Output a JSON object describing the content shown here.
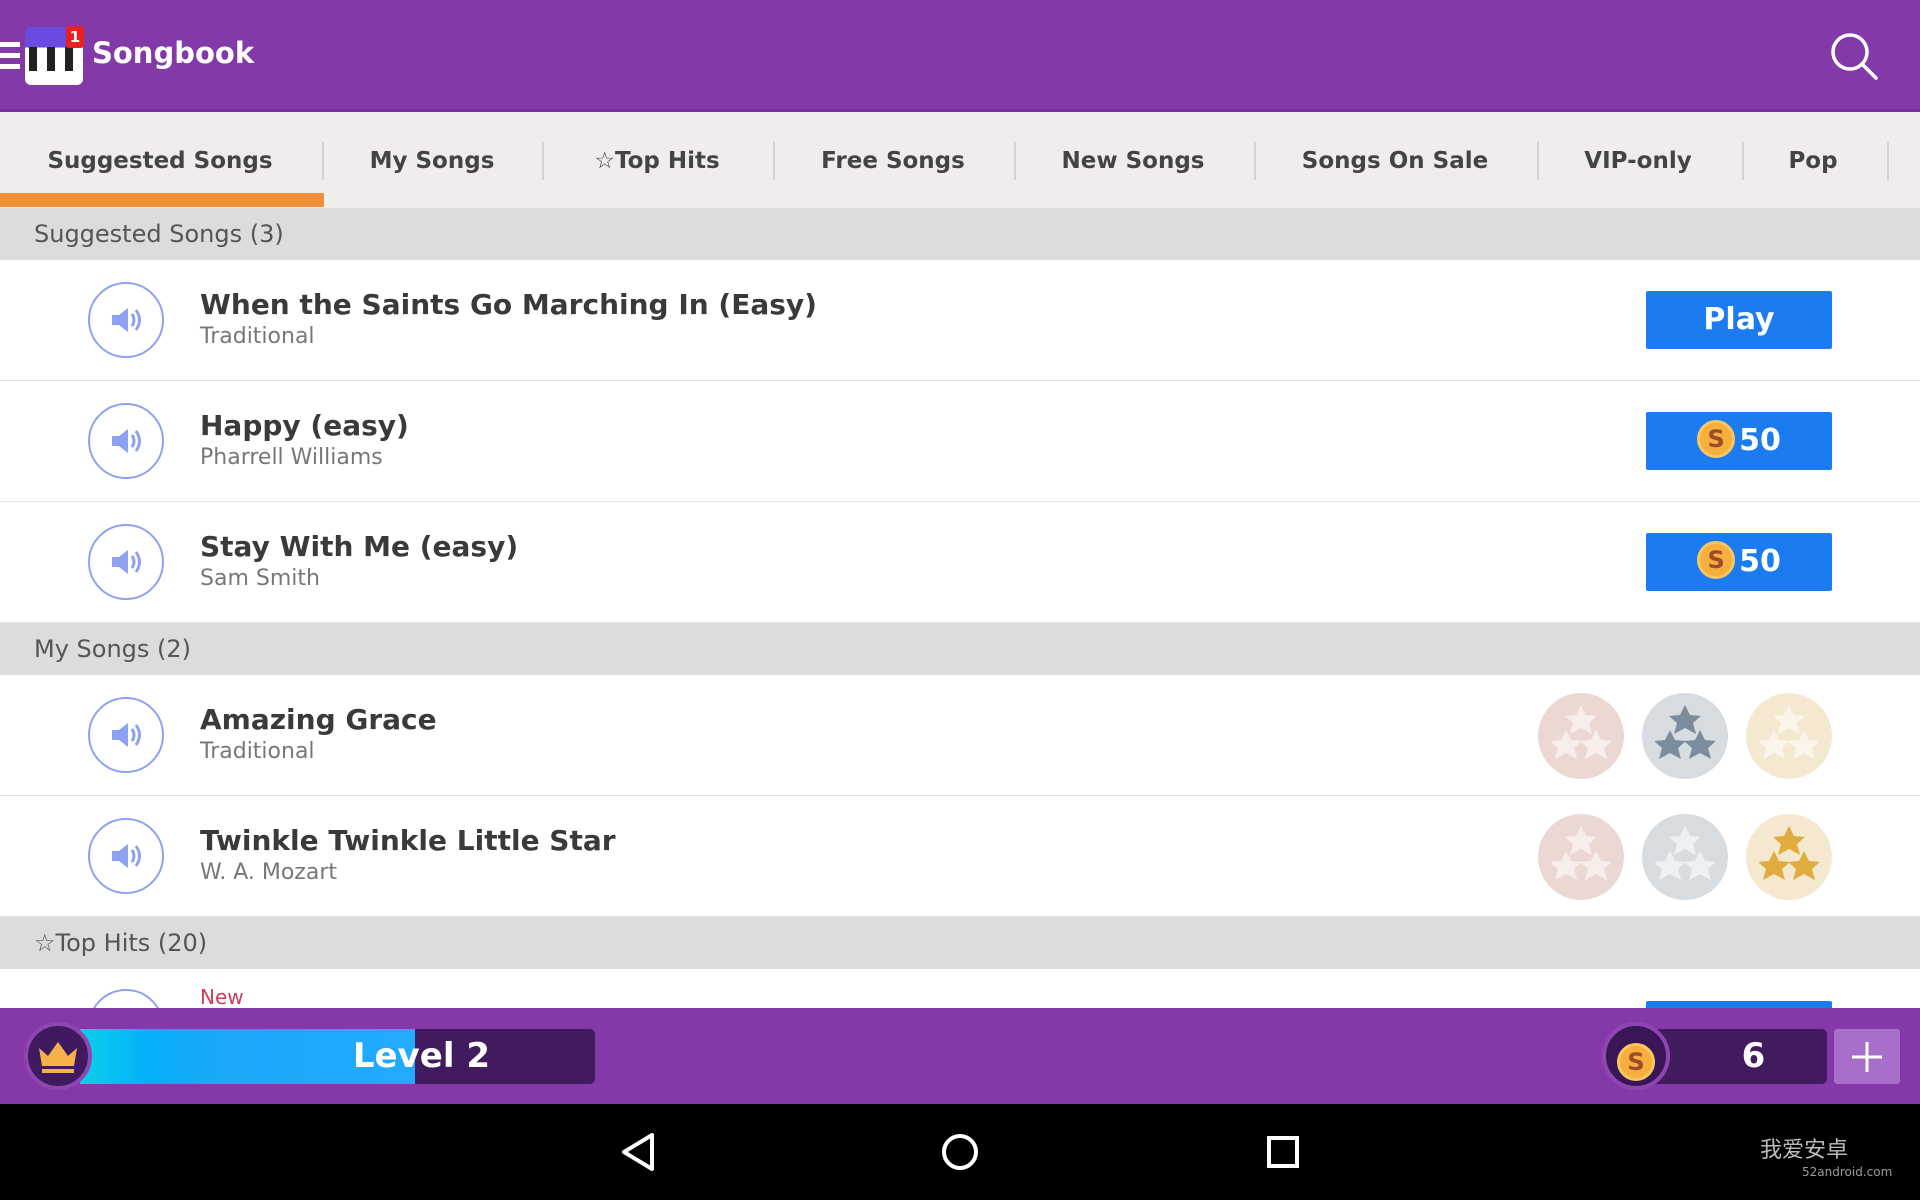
{
  "header": {
    "title": "Songbook",
    "notification_count": "1",
    "bg_color": "#8439a8"
  },
  "tabs": [
    {
      "label": "Suggested Songs",
      "active": true
    },
    {
      "label": "My Songs"
    },
    {
      "label": "☆Top Hits"
    },
    {
      "label": "Free Songs"
    },
    {
      "label": "New Songs"
    },
    {
      "label": "Songs On Sale"
    },
    {
      "label": "VIP-only"
    },
    {
      "label": "Pop"
    }
  ],
  "sections": {
    "suggested": {
      "title": "Suggested Songs (3)",
      "songs": [
        {
          "title": "When the Saints Go Marching In (Easy)",
          "artist": "Traditional",
          "action": "Play"
        },
        {
          "title": "Happy (easy)",
          "artist": "Pharrell Williams",
          "price": "50",
          "coin_symbol": "S"
        },
        {
          "title": "Stay With Me (easy)",
          "artist": "Sam Smith",
          "price": "50",
          "coin_symbol": "S"
        }
      ]
    },
    "my_songs": {
      "title": "My Songs (2)",
      "songs": [
        {
          "title": "Amazing Grace",
          "artist": "Traditional",
          "medal_earned": "silver"
        },
        {
          "title": "Twinkle Twinkle Little Star",
          "artist": "W. A. Mozart",
          "medal_earned": "gold"
        }
      ]
    },
    "top_hits": {
      "title": "☆Top Hits (20)",
      "first_badge": "New"
    }
  },
  "bottom": {
    "level": "Level 2",
    "level_progress": 0.65,
    "coins": "6",
    "coin_symbol": "S"
  },
  "watermark": {
    "text": "我爱安卓",
    "url": "52android.com"
  }
}
